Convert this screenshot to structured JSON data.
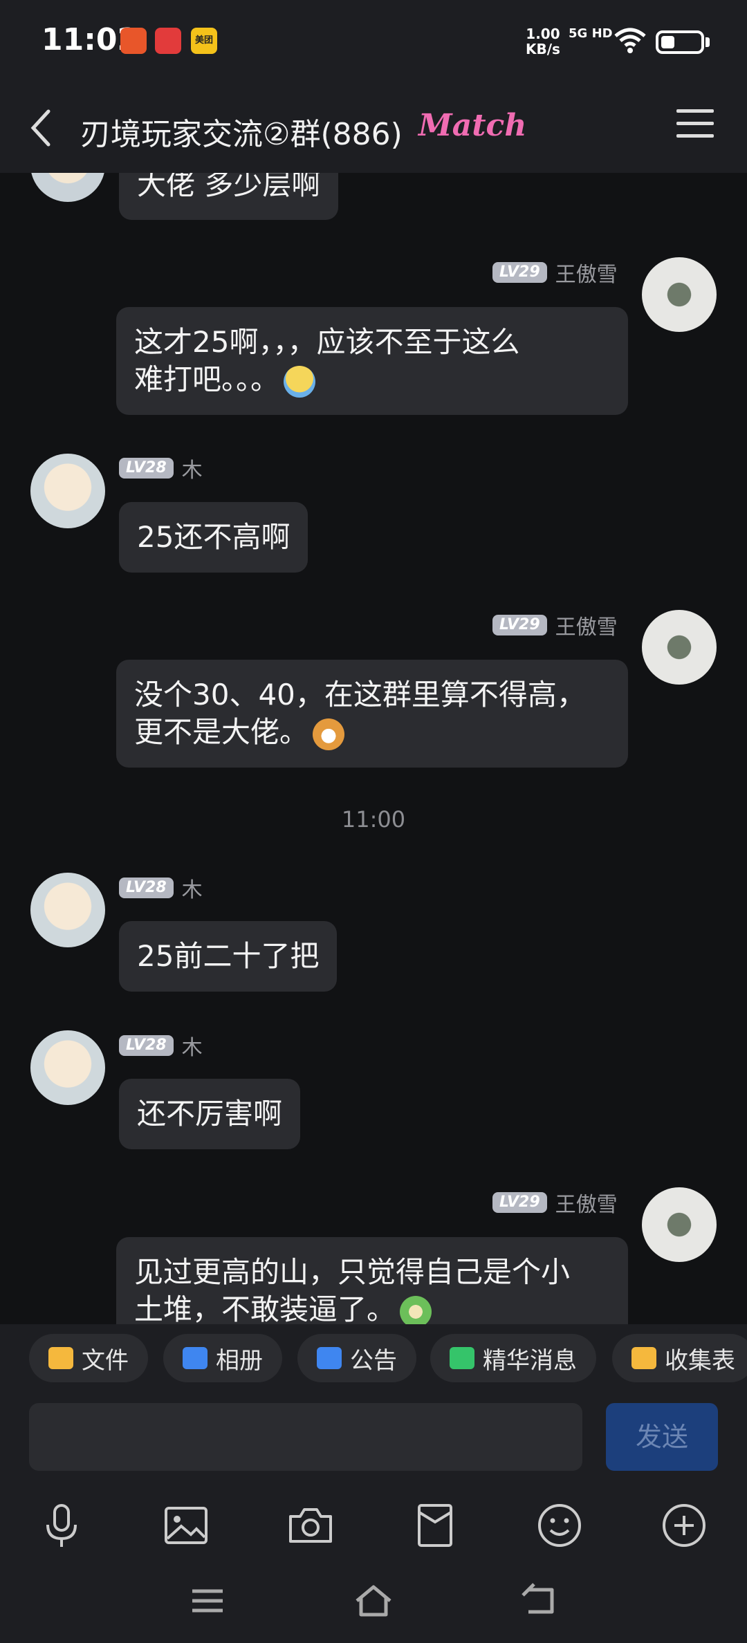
{
  "status_bar": {
    "time": "11:02",
    "apps": [
      "美团"
    ],
    "speed_top": "1.00",
    "speed_bottom": "KB/s",
    "network": "5G HD",
    "battery_level": 0.35
  },
  "header": {
    "title": "刃境玩家交流②群(886)",
    "logo_text": "Match"
  },
  "messages": [
    {
      "side": "left",
      "text": "大佬 多少层啊"
    },
    {
      "side": "right",
      "level": "LV29",
      "name": "王傲雪",
      "lines": [
        "这才25啊，，，应该不至于这么",
        "难打吧。。。"
      ],
      "emoji": "tear-emoji"
    },
    {
      "side": "left",
      "level": "LV28",
      "name": "木",
      "text": "25还不高啊"
    },
    {
      "side": "right",
      "level": "LV29",
      "name": "王傲雪",
      "lines": [
        "没个30、40，在这群里算不得高，",
        "更不是大佬。"
      ],
      "emoji": "dog-emoji"
    },
    {
      "timestamp": "11:00"
    },
    {
      "side": "left",
      "level": "LV28",
      "name": "木",
      "text": "25前二十了把"
    },
    {
      "side": "left",
      "level": "LV28",
      "name": "木",
      "text": "还不厉害啊"
    },
    {
      "side": "right",
      "level": "LV29",
      "name": "王傲雪",
      "lines": [
        "见过更高的山，只觉得自己是个小",
        "土堆，不敢装逼了。"
      ],
      "emoji": "frog-emoji"
    }
  ],
  "quick_actions": [
    {
      "label": "文件",
      "icon": "folder-icon",
      "color": "#f5b83d"
    },
    {
      "label": "相册",
      "icon": "album-icon",
      "color": "#3f86f0"
    },
    {
      "label": "公告",
      "icon": "announcement-icon",
      "color": "#3f86f0"
    },
    {
      "label": "精华消息",
      "icon": "essence-icon",
      "color": "#35c46a"
    },
    {
      "label": "收集表",
      "icon": "form-icon",
      "color": "#f5b83d"
    }
  ],
  "composer": {
    "send_label": "发送"
  },
  "tools": [
    "microphone-icon",
    "image-icon",
    "camera-icon",
    "red-packet-icon",
    "emoji-icon",
    "plus-icon"
  ],
  "nav": [
    "menu-icon",
    "home-icon",
    "back-icon"
  ]
}
